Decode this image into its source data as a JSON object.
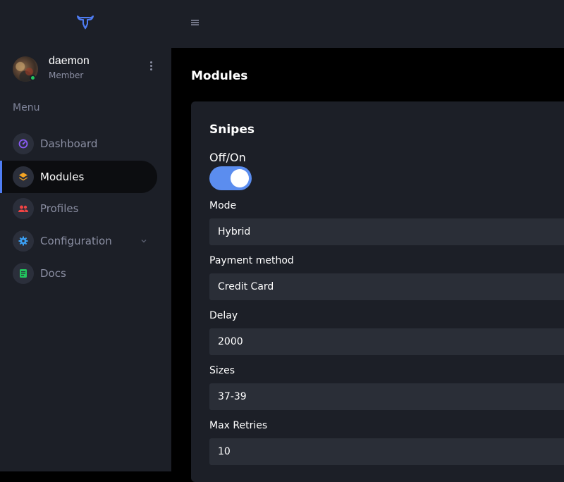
{
  "colors": {
    "sidebar_bg": "#1c1f27",
    "main_bg": "#000000",
    "accent": "#4f7df3",
    "toggle_on": "#5b8def",
    "online": "#22c55e"
  },
  "header": {
    "logo_icon": "bull-logo-icon",
    "menu_icon": "hamburger-icon"
  },
  "user": {
    "name": "daemon",
    "role": "Member",
    "status": "online"
  },
  "sidebar": {
    "section_label": "Menu",
    "items": [
      {
        "label": "Dashboard",
        "icon": "speedometer-icon",
        "icon_color": "#8b5cf6",
        "active": false
      },
      {
        "label": "Modules",
        "icon": "layers-icon",
        "icon_color": "#f5a524",
        "active": true
      },
      {
        "label": "Profiles",
        "icon": "users-icon",
        "icon_color": "#ef4444",
        "active": false
      },
      {
        "label": "Configuration",
        "icon": "gear-icon",
        "icon_color": "#3b9ff3",
        "active": false,
        "expandable": true
      },
      {
        "label": "Docs",
        "icon": "document-icon",
        "icon_color": "#22c55e",
        "active": false
      }
    ]
  },
  "main": {
    "page_title": "Modules",
    "card": {
      "title": "Snipes",
      "toggle": {
        "label": "Off/On",
        "on": true
      },
      "fields": [
        {
          "label": "Mode",
          "value": "Hybrid"
        },
        {
          "label": "Payment method",
          "value": "Credit Card"
        },
        {
          "label": "Delay",
          "value": "2000"
        },
        {
          "label": "Sizes",
          "value": "37-39"
        },
        {
          "label": "Max Retries",
          "value": "10"
        }
      ]
    }
  }
}
